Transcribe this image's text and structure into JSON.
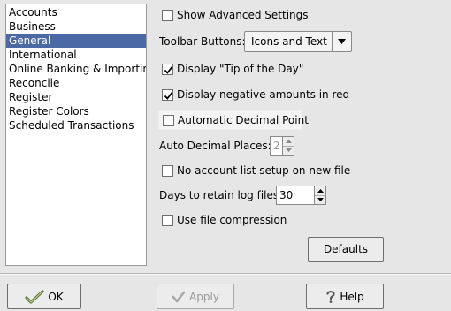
{
  "sidebar": {
    "items": [
      {
        "label": "Accounts",
        "selected": false
      },
      {
        "label": "Business",
        "selected": false
      },
      {
        "label": "General",
        "selected": true
      },
      {
        "label": "International",
        "selected": false
      },
      {
        "label": "Online Banking & Importing",
        "selected": false
      },
      {
        "label": "Reconcile",
        "selected": false
      },
      {
        "label": "Register",
        "selected": false
      },
      {
        "label": "Register Colors",
        "selected": false
      },
      {
        "label": "Scheduled Transactions",
        "selected": false
      }
    ]
  },
  "general": {
    "show_advanced": {
      "label": "Show Advanced Settings",
      "checked": false
    },
    "toolbar_buttons": {
      "label": "Toolbar Buttons:",
      "value": "Icons and Text"
    },
    "tip_of_day": {
      "label": "Display \"Tip of the Day\"",
      "checked": true
    },
    "negative_red": {
      "label": "Display negative amounts in red",
      "checked": true
    },
    "auto_decimal": {
      "label": "Automatic Decimal Point",
      "checked": false
    },
    "auto_decimal_places": {
      "label": "Auto Decimal Places:",
      "value": "2"
    },
    "no_account_list": {
      "label": "No account list setup on new file",
      "checked": false
    },
    "log_retain": {
      "label": "Days to retain log files:",
      "value": "30"
    },
    "file_compression": {
      "label": "Use file compression",
      "checked": false
    },
    "defaults_label": "Defaults"
  },
  "footer": {
    "ok_label": "OK",
    "apply_label": "Apply",
    "help_label": "Help"
  },
  "colors": {
    "selection": "#4b69a5",
    "check": "#000000"
  }
}
